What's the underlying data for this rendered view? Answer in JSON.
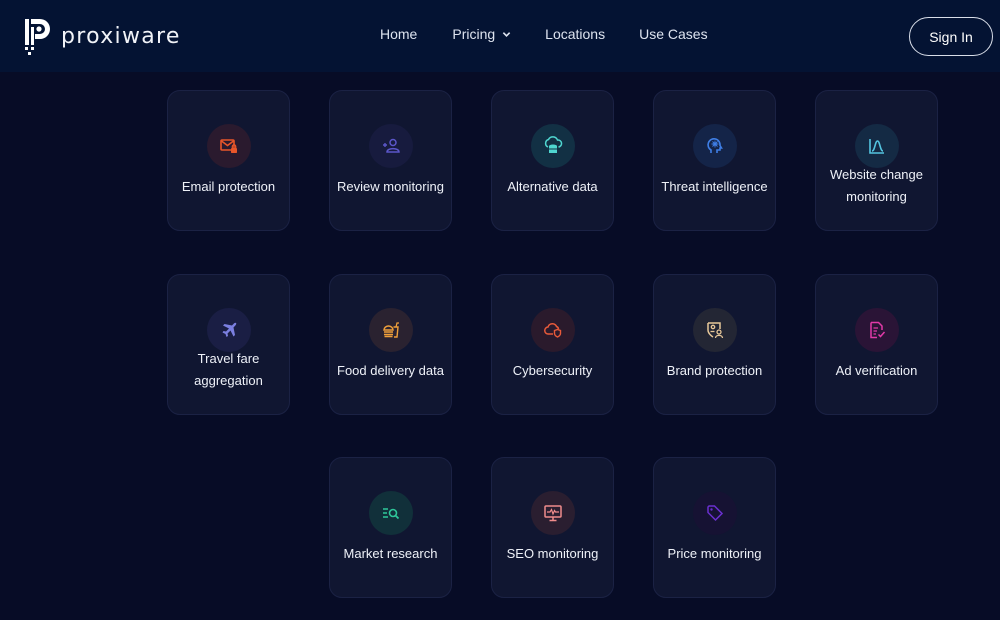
{
  "brand": {
    "name": "proxiware"
  },
  "nav": {
    "links": [
      {
        "label": "Home"
      },
      {
        "label": "Pricing",
        "has_dropdown": true
      },
      {
        "label": "Locations"
      },
      {
        "label": "Use Cases"
      }
    ],
    "signin_label": "Sign In"
  },
  "use_cases": [
    {
      "label": "Email protection",
      "icon": "email-lock-icon",
      "color": "#e8562a"
    },
    {
      "label": "Review monitoring",
      "icon": "user-review-icon",
      "color": "#5b56c9"
    },
    {
      "label": "Alternative data",
      "icon": "cloud-database-icon",
      "color": "#4fd6d0"
    },
    {
      "label": "Threat intelligence",
      "icon": "brain-head-icon",
      "color": "#3f7fe6"
    },
    {
      "label": "Website change monitoring",
      "icon": "chart-curve-icon",
      "color": "#54c5e0"
    },
    {
      "label": "Travel fare aggregation",
      "icon": "airplane-icon",
      "color": "#7b7fe0"
    },
    {
      "label": "Food delivery data",
      "icon": "burger-drink-icon",
      "color": "#f0a03a"
    },
    {
      "label": "Cybersecurity",
      "icon": "cloud-shield-icon",
      "color": "#e85a3a"
    },
    {
      "label": "Brand protection",
      "icon": "shield-users-icon",
      "color": "#e8c89a"
    },
    {
      "label": "Ad verification",
      "icon": "document-check-icon",
      "color": "#e23aa8"
    },
    {
      "label": "Market research",
      "icon": "list-search-icon",
      "color": "#2fc79a"
    },
    {
      "label": "SEO monitoring",
      "icon": "monitor-pulse-icon",
      "color": "#f08c8c"
    },
    {
      "label": "Price monitoring",
      "icon": "price-tag-icon",
      "color": "#6a2fd0"
    }
  ]
}
